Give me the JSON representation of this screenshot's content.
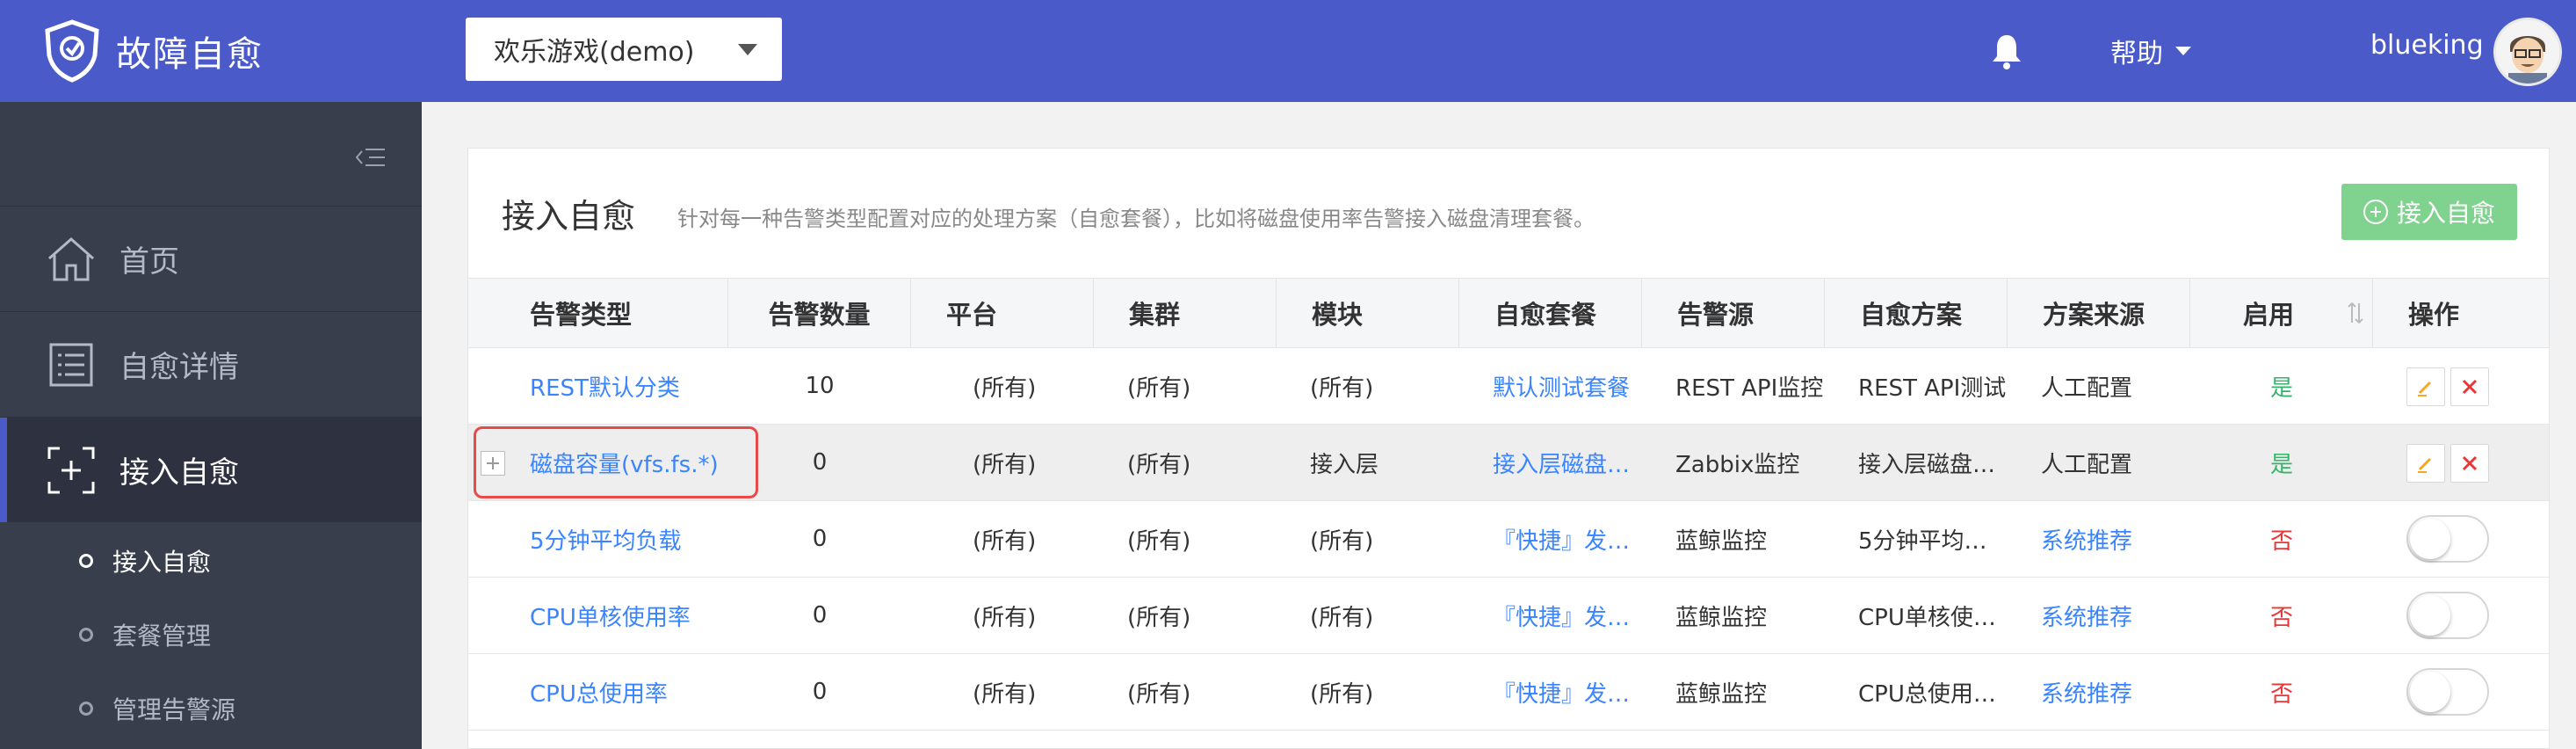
{
  "header": {
    "app_title": "故障自愈",
    "business_select": "欢乐游戏(demo)",
    "help_label": "帮助",
    "username": "blueking"
  },
  "sidebar": {
    "items": [
      {
        "label": "首页",
        "icon": "home-icon"
      },
      {
        "label": "自愈详情",
        "icon": "list-icon"
      },
      {
        "label": "接入自愈",
        "icon": "access-icon",
        "active": true
      }
    ],
    "sub_items": [
      {
        "label": "接入自愈",
        "active": true
      },
      {
        "label": "套餐管理"
      },
      {
        "label": "管理告警源"
      }
    ]
  },
  "main": {
    "title": "接入自愈",
    "description": "针对每一种告警类型配置对应的处理方案（自愈套餐），比如将磁盘使用率告警接入磁盘清理套餐。",
    "add_button": "接入自愈",
    "columns": [
      "告警类型",
      "告警数量",
      "平台",
      "集群",
      "模块",
      "自愈套餐",
      "告警源",
      "自愈方案",
      "方案来源",
      "启用",
      "操作"
    ],
    "rows": [
      {
        "alarm_type": "REST默认分类",
        "count": "10",
        "platform": "(所有)",
        "cluster": "(所有)",
        "module": "(所有)",
        "package": "默认测试套餐",
        "source": "REST API监控",
        "solution": "REST API测试",
        "origin": "人工配置",
        "enabled": "是"
      },
      {
        "alarm_type": "磁盘容量(vfs.fs.*)",
        "count": "0",
        "platform": "(所有)",
        "cluster": "(所有)",
        "module": "接入层",
        "package": "接入层磁盘…",
        "source": "Zabbix监控",
        "solution": "接入层磁盘…",
        "origin": "人工配置",
        "enabled": "是"
      },
      {
        "alarm_type": "5分钟平均负载",
        "count": "0",
        "platform": "(所有)",
        "cluster": "(所有)",
        "module": "(所有)",
        "package": "『快捷』发…",
        "source": "蓝鲸监控",
        "solution": "5分钟平均…",
        "origin": "系统推荐",
        "enabled": "否"
      },
      {
        "alarm_type": "CPU单核使用率",
        "count": "0",
        "platform": "(所有)",
        "cluster": "(所有)",
        "module": "(所有)",
        "package": "『快捷』发…",
        "source": "蓝鲸监控",
        "solution": "CPU单核使…",
        "origin": "系统推荐",
        "enabled": "否"
      },
      {
        "alarm_type": "CPU总使用率",
        "count": "0",
        "platform": "(所有)",
        "cluster": "(所有)",
        "module": "(所有)",
        "package": "『快捷』发…",
        "source": "蓝鲸监控",
        "solution": "CPU总使用…",
        "origin": "系统推荐",
        "enabled": "否"
      }
    ]
  },
  "colors": {
    "header_bg": "#4a5ac8",
    "sidebar_bg": "#393e4c",
    "link": "#3a84ff",
    "yes": "#36b36b",
    "no": "#ea3636",
    "add_button_bg": "#7fd38f"
  }
}
